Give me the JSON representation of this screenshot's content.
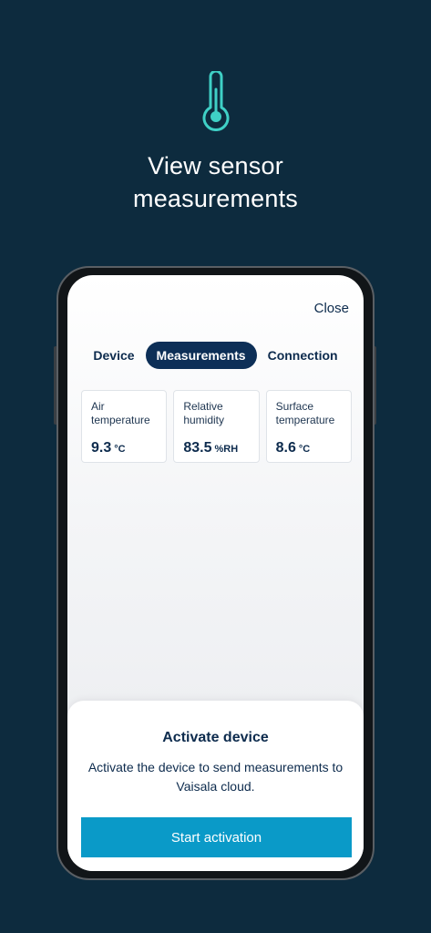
{
  "hero": {
    "icon": "thermometer-icon",
    "title_line1": "View sensor",
    "title_line2": "measurements"
  },
  "header": {
    "close_label": "Close"
  },
  "tabs": [
    {
      "label": "Device",
      "active": false
    },
    {
      "label": "Measurements",
      "active": true
    },
    {
      "label": "Connection",
      "active": false
    }
  ],
  "measurements": [
    {
      "label": "Air temperature",
      "value": "9.3",
      "unit": "°C"
    },
    {
      "label": "Relative humidity",
      "value": "83.5",
      "unit": "%RH"
    },
    {
      "label": "Surface temperature",
      "value": "8.6",
      "unit": "°C"
    }
  ],
  "sheet": {
    "title": "Activate device",
    "description": "Activate the device to send measurements to Vaisala cloud.",
    "button_label": "Start activation"
  },
  "colors": {
    "background": "#0d2b3e",
    "accent_teal": "#3fd0c6",
    "navy": "#0d2f57",
    "button_blue": "#0a9ac8"
  }
}
